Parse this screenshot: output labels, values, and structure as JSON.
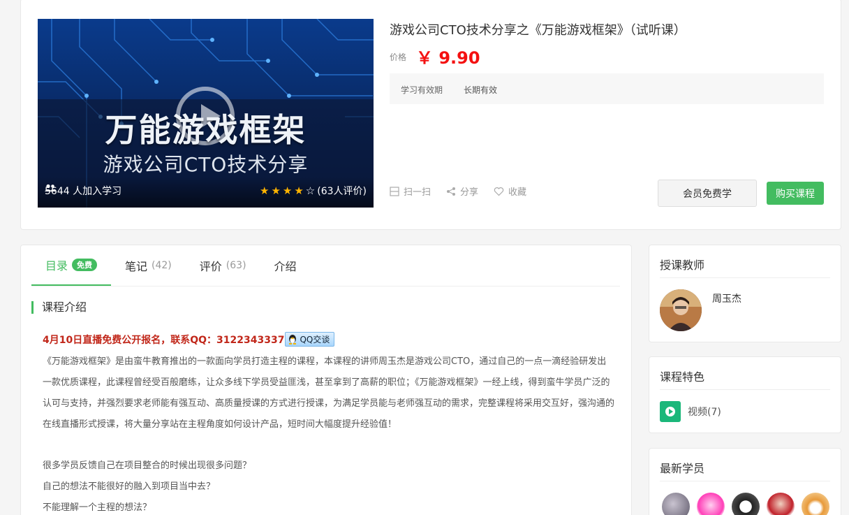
{
  "course": {
    "cover_title": "万能游戏框架",
    "cover_subtitle": "游戏公司CTO技术分享",
    "learners": "5644 人加入学习",
    "rating_text": "(63人评价)",
    "rating_stars": 4,
    "title": "游戏公司CTO技术分享之《万能游戏框架》（试听课）",
    "price_label": "价格",
    "price": "￥ 9.90",
    "validity_label": "学习有效期",
    "validity_value": "长期有效",
    "actions": {
      "scan": "扫一扫",
      "share": "分享",
      "favorite": "收藏"
    },
    "member_button": "会员免费学",
    "buy_button": "购买课程"
  },
  "tabs": [
    {
      "label": "目录",
      "badge": "免费"
    },
    {
      "label": "笔记",
      "count": "(42)"
    },
    {
      "label": "评价",
      "count": "(63)"
    },
    {
      "label": "介绍"
    }
  ],
  "intro": {
    "heading": "课程介绍",
    "notice": "4月10日直播免费公开报名，联系QQ：3122343337",
    "qq_button": "QQ交谈",
    "description": "《万能游戏框架》是由蛮牛教育推出的一款面向学员打造主程的课程，本课程的讲师周玉杰是游戏公司CTO，通过自己的一点一滴经验研发出一款优质课程，此课程曾经受百般磨练，让众多线下学员受益匪浅，甚至拿到了高薪的职位；《万能游戏框架》一经上线，得到蛮牛学员广泛的认可与支持，并强烈要求老师能有强互动、高质量授课的方式进行授课，为满足学员能与老师强互动的需求，完整课程将采用交互好，强沟通的在线直播形式授课，将大量分享站在主程角度如何设计产品，短时间大幅度提升经验值！",
    "questions": [
      "很多学员反馈自己在项目整合的时候出现很多问题？",
      "自己的想法不能很好的融入到项目当中去？",
      "不能理解一个主程的想法？"
    ]
  },
  "sidebar": {
    "teacher_heading": "授课教师",
    "teacher_name": "周玉杰",
    "features_heading": "课程特色",
    "feature_video": "视频(7)",
    "students_heading": "最新学员"
  },
  "colors": {
    "accent": "#43bc60",
    "price": "#f41111",
    "notice": "#c1271a"
  }
}
